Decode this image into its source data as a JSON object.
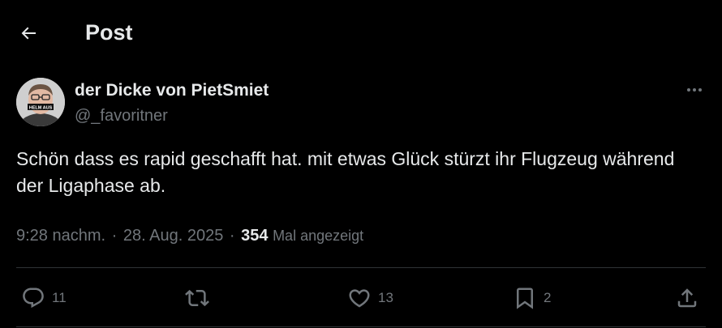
{
  "header": {
    "title": "Post",
    "back_icon": "arrow-left-icon"
  },
  "post": {
    "author_name": "der Dicke von PietSmiet",
    "author_handle": "@_favoritner",
    "avatar_caption": "HELM AUS",
    "text": "Schön dass es rapid geschafft hat. mit etwas Glück stürzt ihr Flugzeug während der Ligaphase ab.",
    "time": "9:28 nachm.",
    "date": "28. Aug. 2025",
    "separator": "·",
    "views_count": "354",
    "views_label": "Mal angezeigt"
  },
  "actions": {
    "reply_count": "11",
    "repost_count": "",
    "like_count": "13",
    "bookmark_count": "2"
  },
  "colors": {
    "background": "#000000",
    "text_primary": "#e7e9ea",
    "text_secondary": "#71767b",
    "divider": "#2f3336"
  }
}
